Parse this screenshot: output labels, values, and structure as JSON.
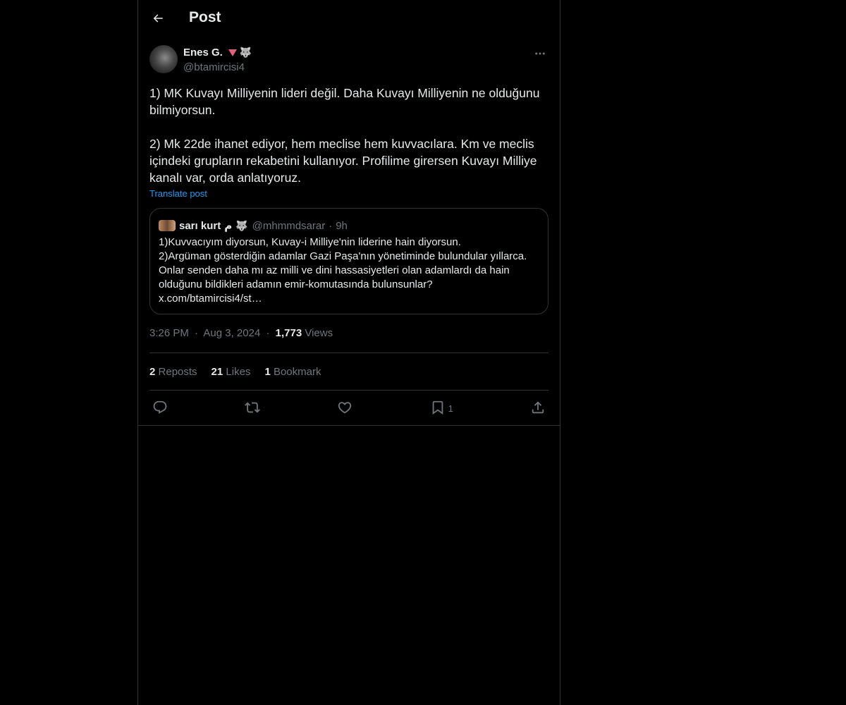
{
  "header": {
    "title": "Post"
  },
  "post": {
    "author_name": "Enes G.",
    "author_handle": "@btamircisi4",
    "author_emoji": "🐺",
    "text": "1) MK Kuvayı Milliyenin lideri değil. Daha Kuvayı Milliyenin ne olduğunu bilmiyorsun.\n\n2) Mk 22de ihanet ediyor, hem meclise hem kuvvacılara. Km ve meclis içindeki grupların rekabetini kullanıyor. Profilime girersen Kuvayı Milliye kanalı var, orda anlatıyoruz.",
    "translate_label": "Translate post",
    "time": "3:26 PM",
    "date": "Aug 3, 2024",
    "views_count": "1,773",
    "views_label": "Views",
    "separator": "·"
  },
  "quote": {
    "author_name": "sarı kurt",
    "author_glyph": "م",
    "author_emoji": "🐺",
    "author_handle": "@mhmmdsarar",
    "time": "9h",
    "text": "1)Kuvvacıyım diyorsun, Kuvay-i Milliye'nin liderine hain diyorsun.\n2)Argüman gösterdiğin adamlar Gazi Paşa'nın yönetiminde bulundular yıllarca. Onlar senden daha mı az  milli ve dini hassasiyetleri olan adamlardı da hain olduğunu bildikleri adamın emir-komutasında bulunsunlar?\nx.com/btamircisi4/st…"
  },
  "stats": {
    "reposts_count": "2",
    "reposts_label": "Reposts",
    "likes_count": "21",
    "likes_label": "Likes",
    "bookmarks_count": "1",
    "bookmarks_label": "Bookmark"
  },
  "actions": {
    "bookmark_count": "1"
  },
  "colors": {
    "background": "#000000",
    "border": "#2f3336",
    "text_primary": "#e7e9ea",
    "text_secondary": "#71767b",
    "link": "#1d9bf0",
    "badge": "#e0607e"
  },
  "icons": [
    "back-arrow-icon",
    "more-icon",
    "reply-icon",
    "repost-icon",
    "like-icon",
    "bookmark-icon",
    "share-icon"
  ]
}
